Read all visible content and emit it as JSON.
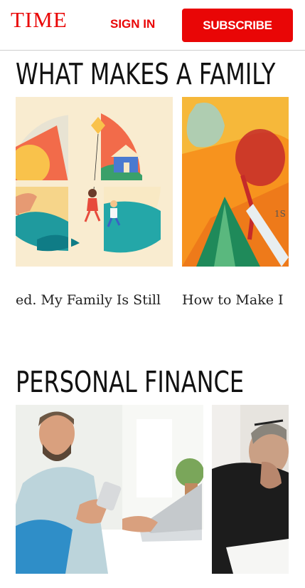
{
  "header": {
    "logo_text": "TIME",
    "sign_in_label": "SIGN IN",
    "subscribe_label": "SUBSCRIBE",
    "brand_color": "#e90606"
  },
  "sections": [
    {
      "title": "WHAT MAKES A FAMILY",
      "cards": [
        {
          "caption": "ed. My Family Is Still",
          "image": "paper-cut-family-illustration"
        },
        {
          "caption": "How to Make I",
          "image": "orange-painted-wine-glass-illustration"
        }
      ]
    },
    {
      "title": "PERSONAL FINANCE",
      "cards": [
        {
          "caption": "",
          "image": "smiling-man-with-phone-and-laptop-photo"
        },
        {
          "caption": "",
          "image": "worried-man-hand-on-chin-photo"
        }
      ]
    }
  ]
}
